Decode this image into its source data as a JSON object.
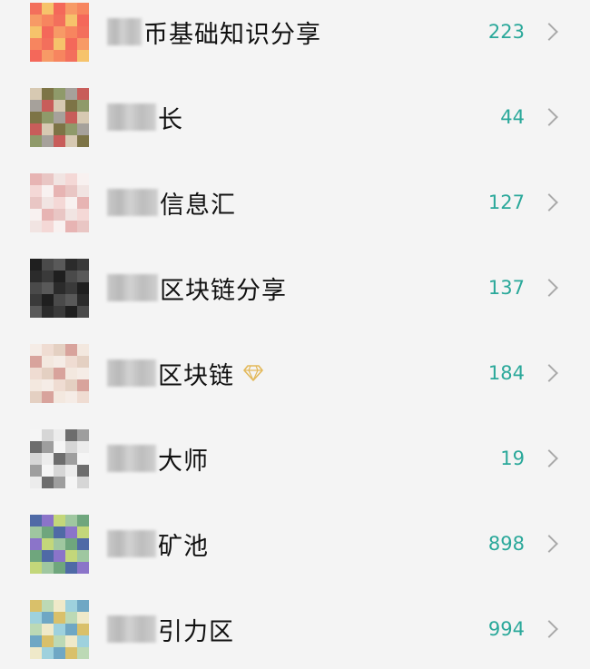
{
  "groups": [
    {
      "name": "币基础知识分享",
      "count": "223",
      "badge": "",
      "avatar_palette": [
        "#f36f5c",
        "#f79a66",
        "#f6c36b",
        "#f7855f",
        "#f4685a"
      ]
    },
    {
      "name": "长",
      "count": "44",
      "badge": "",
      "avatar_palette": [
        "#7d7446",
        "#c85d5a",
        "#8f9a6a",
        "#d7c9b2",
        "#a6a19b"
      ]
    },
    {
      "name": "信息汇",
      "count": "127",
      "badge": "",
      "avatar_palette": [
        "#f1e4e2",
        "#e7b4b3",
        "#f4d8d6",
        "#e9c6c4",
        "#f8f1f0"
      ]
    },
    {
      "name": "区块链分享",
      "count": "137",
      "badge": "",
      "avatar_palette": [
        "#2b2b2b",
        "#4a4a4a",
        "#3a3a3a",
        "#595959",
        "#1f1f1f"
      ]
    },
    {
      "name": "区块链",
      "count": "184",
      "badge": "diamond-icon",
      "avatar_palette": [
        "#f3e8df",
        "#e4d0c2",
        "#f5ece6",
        "#d8a39c",
        "#efdcd2"
      ]
    },
    {
      "name": "大师",
      "count": "19",
      "badge": "",
      "avatar_palette": [
        "#f5f5f5",
        "#6d6d6d",
        "#d6d6d6",
        "#9e9e9e",
        "#ececec"
      ]
    },
    {
      "name": "矿池",
      "count": "898",
      "badge": "",
      "avatar_palette": [
        "#8b74c9",
        "#6fa67d",
        "#c3d77a",
        "#4f6aa6",
        "#9fc7a0"
      ]
    },
    {
      "name": "引力区",
      "count": "994",
      "badge": "",
      "avatar_palette": [
        "#efe9c9",
        "#d9c06a",
        "#9ed1dd",
        "#bcd9b5",
        "#6fa7c4"
      ]
    }
  ],
  "colors": {
    "background": "#f4f4f4",
    "count": "#2aa89a",
    "chevron": "#a9a9a9",
    "name": "#111111",
    "diamond": "#e3b95a"
  }
}
